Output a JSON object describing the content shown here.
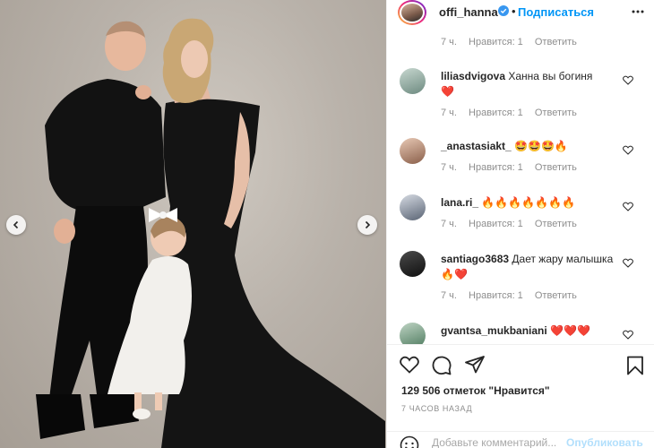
{
  "post": {
    "username": "offi_hanna",
    "follow_label": "Подписаться",
    "separator": "•"
  },
  "comments": [
    {
      "username": "",
      "text": "",
      "time": "7 ч.",
      "likes": "Нравится: 1",
      "reply": "Ответить"
    },
    {
      "username": "liliasdvigova",
      "text": "Ханна вы богиня",
      "emoji": "❤️",
      "time": "7 ч.",
      "likes": "Нравится: 1",
      "reply": "Ответить"
    },
    {
      "username": "_anastasiakt_",
      "text": "",
      "emoji": "🤩🤩🤩🔥",
      "time": "7 ч.",
      "likes": "Нравится: 1",
      "reply": "Ответить"
    },
    {
      "username": "lana.ri_",
      "text": "",
      "emoji": "🔥🔥🔥🔥🔥🔥🔥",
      "time": "7 ч.",
      "likes": "Нравится: 1",
      "reply": "Ответить"
    },
    {
      "username": "santiago3683",
      "text": "Дает жару малышка",
      "emoji": "🔥❤️",
      "time": "7 ч.",
      "likes": "Нравится: 1",
      "reply": "Ответить"
    },
    {
      "username": "gvantsa_mukbaniani",
      "text": "",
      "emoji": "❤️❤️❤️",
      "time": "",
      "likes": "",
      "reply": ""
    }
  ],
  "actions": {
    "likes_count": "129 506 отметок \"Нравится\"",
    "time_ago": "7 ЧАСОВ НАЗАД",
    "comment_placeholder": "Добавьте комментарий...",
    "publish_label": "Опубликовать"
  },
  "icons": {
    "like": "heart-icon",
    "comment": "comment-icon",
    "share": "paper-plane-icon",
    "save": "bookmark-icon",
    "emoji": "smiley-icon",
    "more": "more-icon",
    "verified": "verified-badge-icon",
    "prev": "chevron-left-icon",
    "next": "chevron-right-icon"
  },
  "colors": {
    "accent": "#0095f6",
    "publish_disabled": "#b2dffc",
    "muted": "#8e8e8e",
    "text": "#262626"
  }
}
